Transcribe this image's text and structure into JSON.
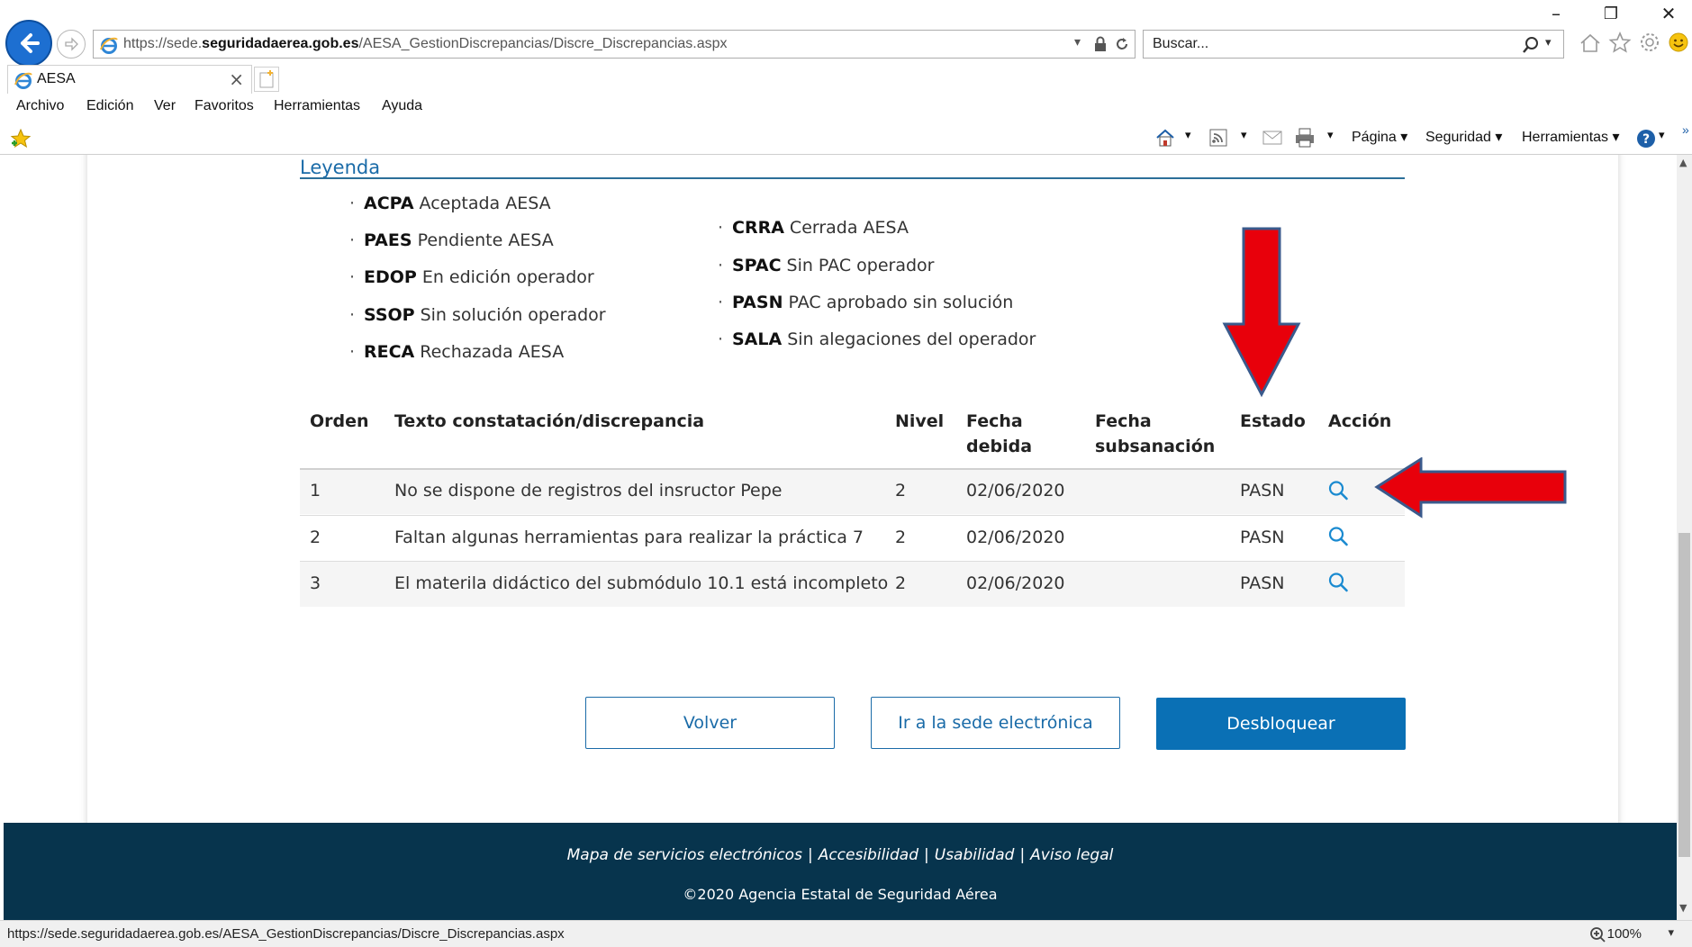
{
  "browser": {
    "url_prefix": "https://sede.",
    "url_domain": "seguridadaerea.gob.es",
    "url_path": "/AESA_GestionDiscrepancias/Discre_Discrepancias.aspx",
    "search_placeholder": "Buscar...",
    "tab_title": "AESA",
    "menu": [
      "Archivo",
      "Edición",
      "Ver",
      "Favoritos",
      "Herramientas",
      "Ayuda"
    ],
    "command_bar": {
      "page": "Página ▾",
      "security": "Seguridad ▾",
      "tools": "Herramientas ▾"
    },
    "status_url": "https://sede.seguridadaerea.gob.es/AESA_GestionDiscrepancias/Discre_Discrepancias.aspx",
    "zoom": "100%"
  },
  "legend": {
    "title": "Leyenda",
    "left": [
      {
        "code": "ACPA",
        "text": "Aceptada AESA"
      },
      {
        "code": "PAES",
        "text": "Pendiente AESA"
      },
      {
        "code": "EDOP",
        "text": "En edición operador"
      },
      {
        "code": "SSOP",
        "text": "Sin solución operador"
      },
      {
        "code": "RECA",
        "text": "Rechazada AESA"
      }
    ],
    "right": [
      {
        "code": "CRRA",
        "text": "Cerrada AESA"
      },
      {
        "code": "SPAC",
        "text": "Sin PAC operador"
      },
      {
        "code": "PASN",
        "text": "PAC aprobado sin solución"
      },
      {
        "code": "SALA",
        "text": "Sin alegaciones del operador"
      }
    ]
  },
  "table": {
    "headers": {
      "orden": "Orden",
      "texto": "Texto constatación/discrepancia",
      "nivel": "Nivel",
      "fecha_debida_1": "Fecha",
      "fecha_debida_2": "debida",
      "fecha_sub_1": "Fecha",
      "fecha_sub_2": "subsanación",
      "estado": "Estado",
      "accion": "Acción"
    },
    "rows": [
      {
        "orden": "1",
        "texto": "No se dispone de registros del insructor Pepe",
        "nivel": "2",
        "fecha_debida": "02/06/2020",
        "fecha_sub": "",
        "estado": "PASN"
      },
      {
        "orden": "2",
        "texto": "Faltan algunas herramientas para realizar la práctica 7",
        "nivel": "2",
        "fecha_debida": "02/06/2020",
        "fecha_sub": "",
        "estado": "PASN"
      },
      {
        "orden": "3",
        "texto": "El materila didáctico del submódulo 10.1 está incompleto",
        "nivel": "2",
        "fecha_debida": "02/06/2020",
        "fecha_sub": "",
        "estado": "PASN"
      }
    ]
  },
  "buttons": {
    "volver": "Volver",
    "sede": "Ir a la sede electrónica",
    "desbloquear": "Desbloquear"
  },
  "footer": {
    "links": [
      "Mapa de servicios electrónicos",
      "Accesibilidad",
      "Usabilidad",
      "Aviso legal"
    ],
    "copyright": "©2020 Agencia Estatal de Seguridad Aérea"
  },
  "colors": {
    "accent": "#0a70b5",
    "footer_bg": "#07344d",
    "annotation_arrow": "#e8000b"
  }
}
